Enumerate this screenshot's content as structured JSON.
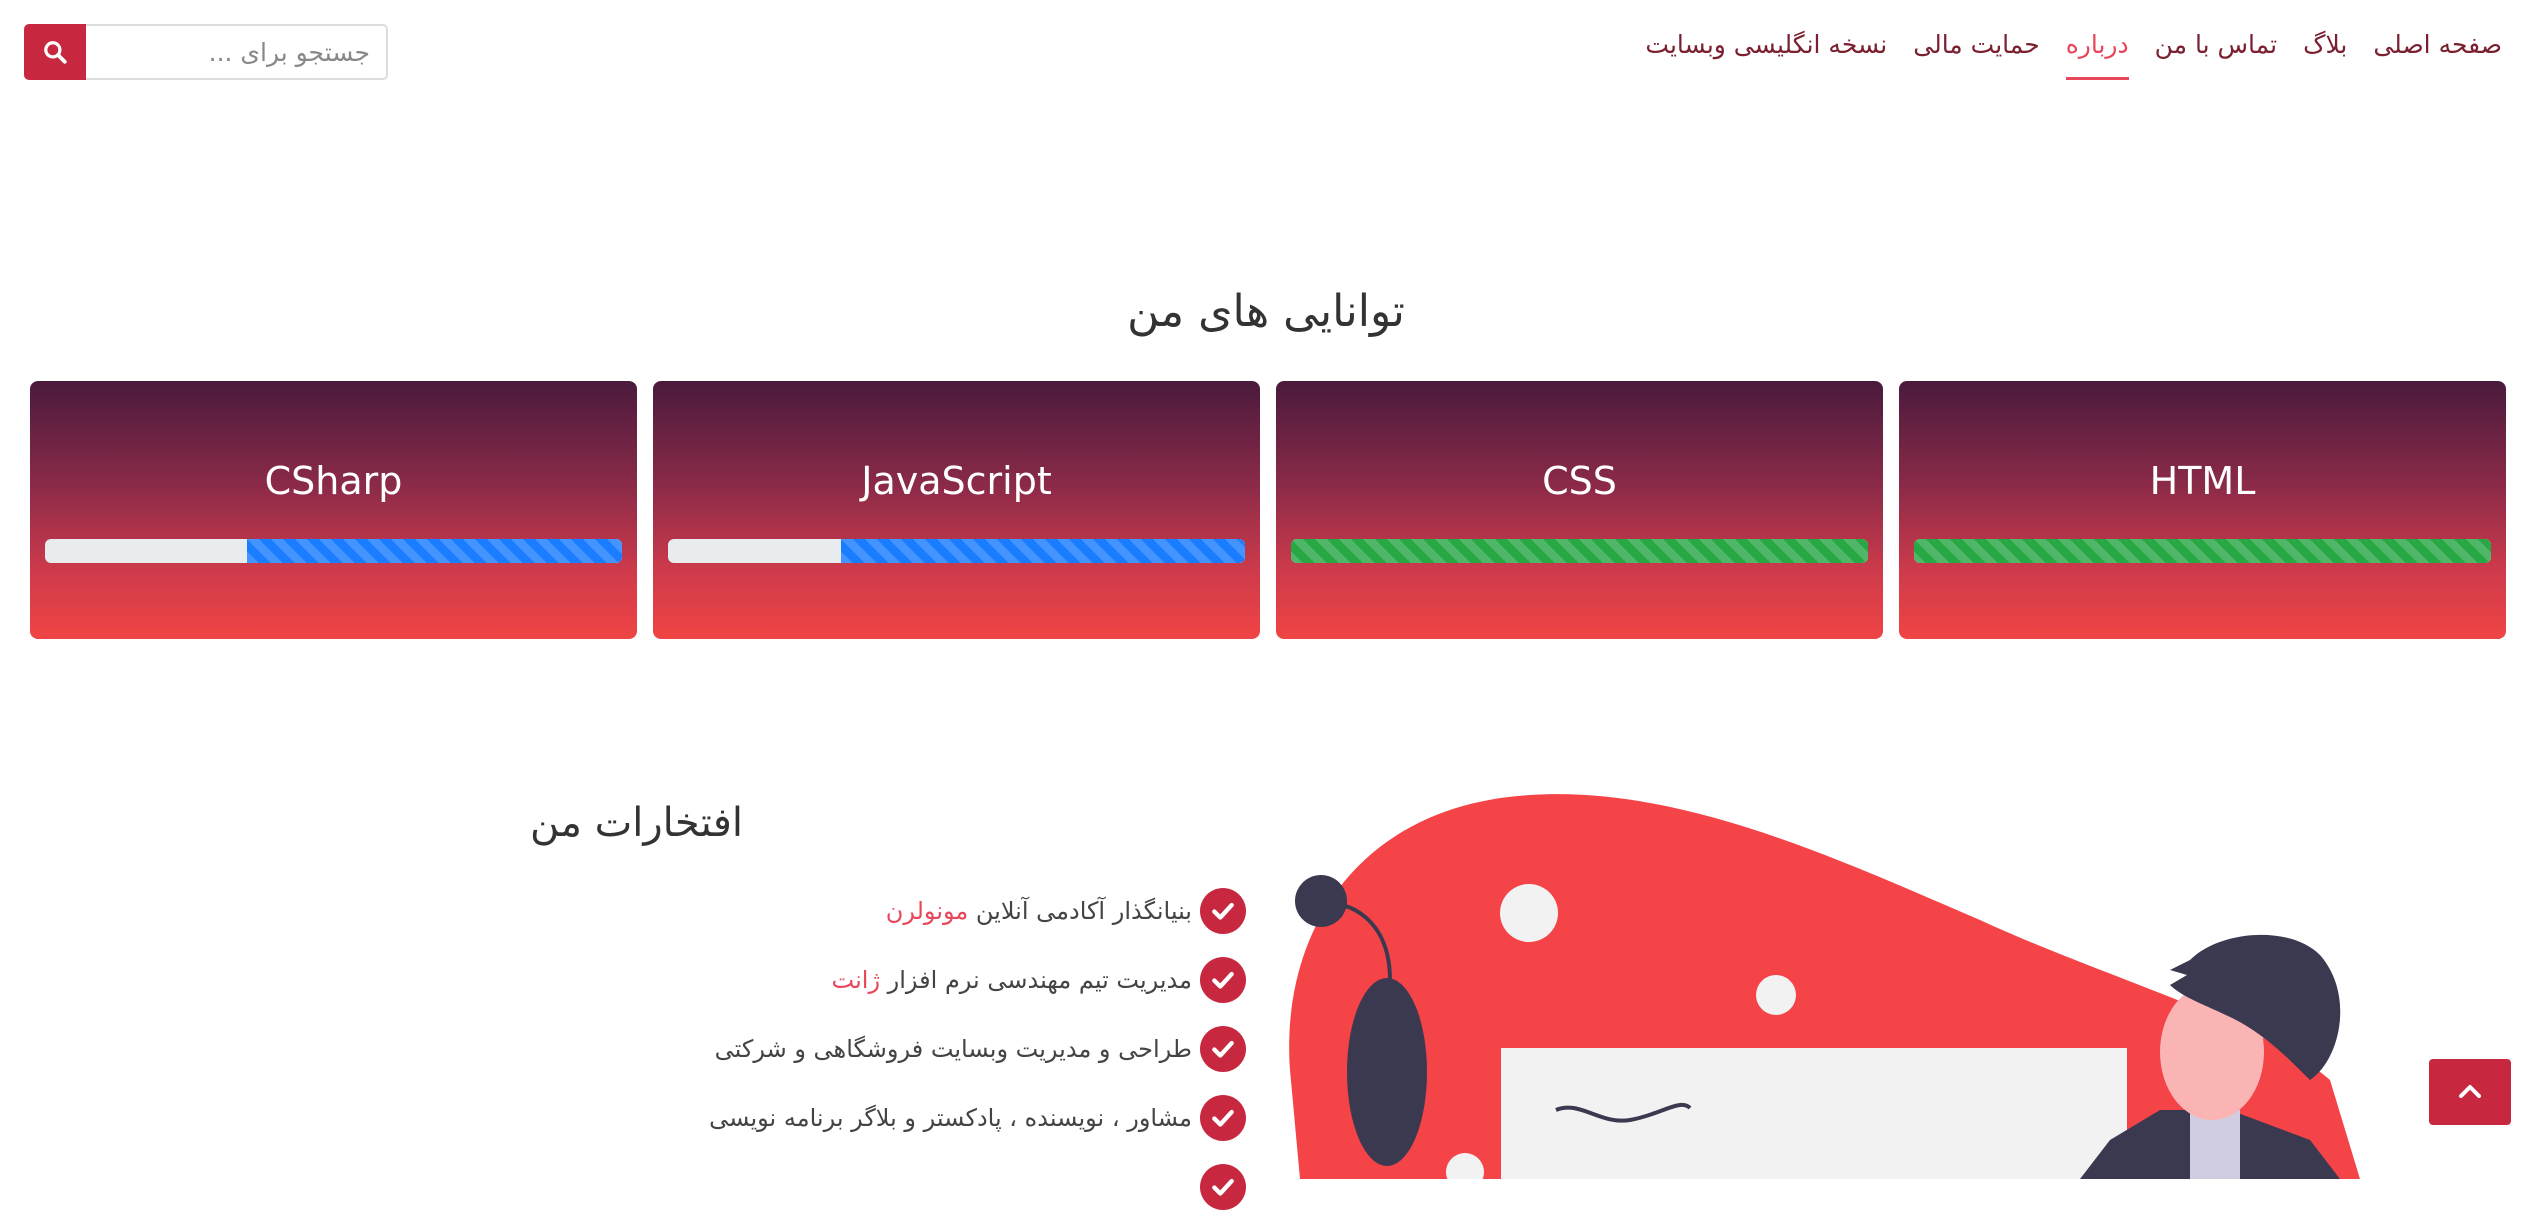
{
  "nav": {
    "items": [
      {
        "label": "صفحه اصلی",
        "active": false
      },
      {
        "label": "بلاگ",
        "active": false
      },
      {
        "label": "تماس با من",
        "active": false
      },
      {
        "label": "درباره",
        "active": true
      },
      {
        "label": "حمایت مالی",
        "active": false
      },
      {
        "label": "نسخه انگلیسی وبسایت",
        "active": false
      }
    ]
  },
  "search": {
    "placeholder": "جستجو برای ...",
    "icon": "search-icon"
  },
  "skills": {
    "title": "توانایی های من",
    "items": [
      {
        "name": "HTML",
        "level": 1.0,
        "color": "#28a745"
      },
      {
        "name": "CSS",
        "level": 1.0,
        "color": "#28a745"
      },
      {
        "name": "JavaScript",
        "level": 0.7,
        "color": "#1a7cff"
      },
      {
        "name": "CSharp",
        "level": 0.65,
        "color": "#1a7cff"
      }
    ]
  },
  "honors": {
    "title": "افتخارات من",
    "items": [
      {
        "text": "بنیانگذار آکادمی آنلاین ",
        "highlight": "مونولرن"
      },
      {
        "text": "مدیریت تیم مهندسی نرم افزار ",
        "highlight": "ژانت"
      },
      {
        "text": "طراحی و مدیریت وبسایت فروشگاهی و شرکتی",
        "highlight": ""
      },
      {
        "text": "مشاور ، نویسنده ، پادکستر و بلاگر برنامه نویسی",
        "highlight": ""
      }
    ]
  },
  "colors": {
    "accent": "#c8283f",
    "link": "#7a2030",
    "active_link": "#e8475b"
  },
  "back_to_top": {
    "icon": "chevron-up-icon"
  }
}
